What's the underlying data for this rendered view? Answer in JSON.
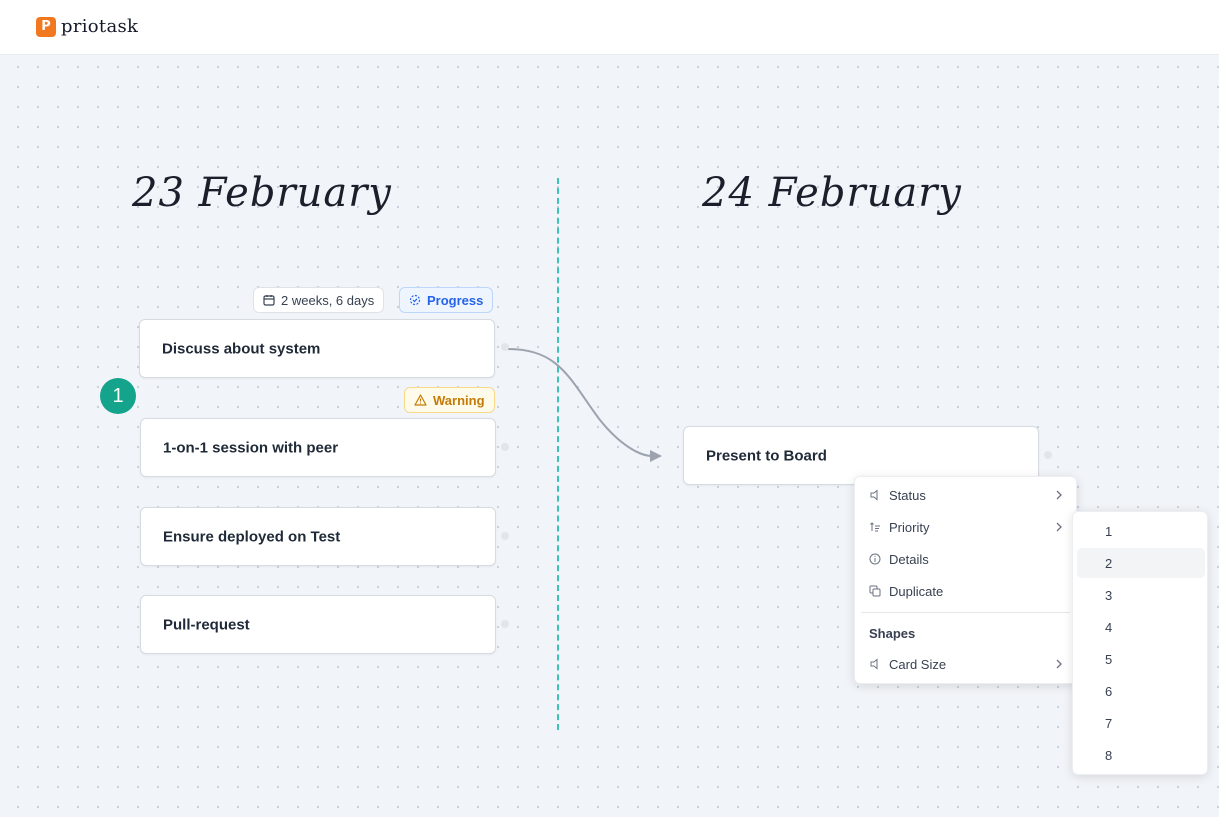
{
  "app": {
    "logo_letter": "P",
    "name": "priotask",
    "brand_color": "#f2781f"
  },
  "days": [
    {
      "title": "23 February"
    },
    {
      "title": "24 February"
    }
  ],
  "cards": [
    {
      "label": "Discuss about system"
    },
    {
      "label": "1-on-1 session with peer"
    },
    {
      "label": "Ensure deployed on Test"
    },
    {
      "label": "Pull-request"
    },
    {
      "label": "Present to Board"
    }
  ],
  "tags": {
    "duration": "2 weeks, 6 days",
    "status": "Progress",
    "warning": "Warning"
  },
  "badge": {
    "value": "1",
    "color": "#14a38b"
  },
  "context_menu": {
    "items": [
      {
        "label": "Status",
        "icon": "status-icon"
      },
      {
        "label": "Priority",
        "icon": "priority-icon"
      },
      {
        "label": "Details",
        "icon": "info-icon"
      },
      {
        "label": "Duplicate",
        "icon": "duplicate-icon"
      }
    ],
    "section_heading": "Shapes",
    "section_items": [
      {
        "label": "Card Size",
        "icon": "card-size-icon"
      }
    ]
  },
  "priority_submenu": {
    "options": [
      "1",
      "2",
      "3",
      "4",
      "5",
      "6",
      "7",
      "8"
    ],
    "highlighted": "2"
  },
  "colors": {
    "divider": "#3cc3b6",
    "progress": "#2563eb",
    "warning": "#c47a06"
  }
}
